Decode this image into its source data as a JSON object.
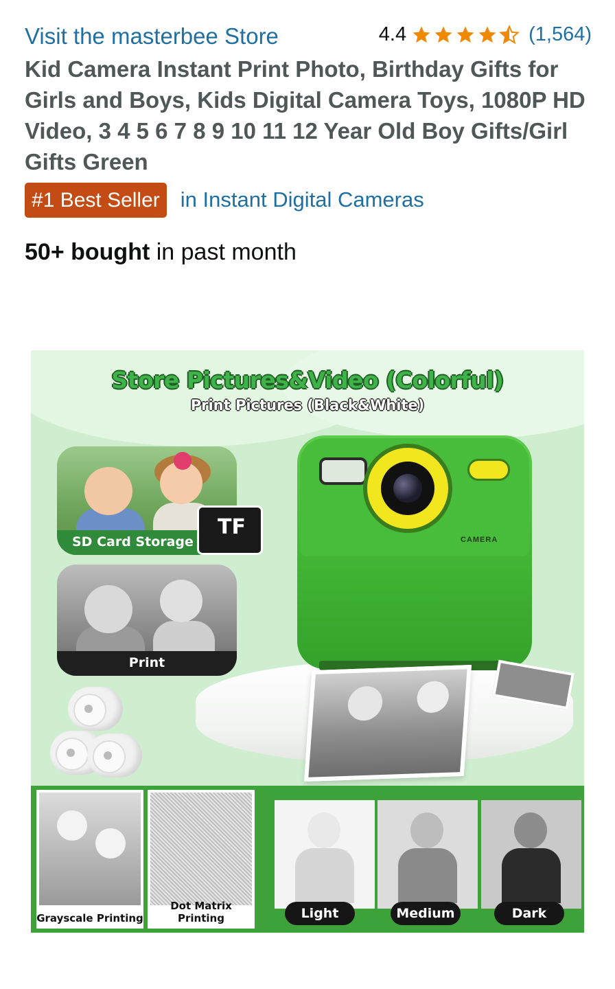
{
  "store": {
    "link_text": "Visit the masterbee Store",
    "rating_value": "4.4",
    "rating_stars": 4.4,
    "rating_count": "(1,564)",
    "star_color": "#f08804"
  },
  "product": {
    "title": "Kid Camera Instant Print Photo, Birthday Gifts for Girls and Boys, Kids Digital Camera Toys, 1080P HD Video, 3 4 5 6 7 8 9 10 11 12 Year Old Boy Gifts/Girl Gifts Green",
    "badge": "#1 Best Seller",
    "badge_category": "in Instant Digital Cameras",
    "bought_bold": "50+ bought",
    "bought_rest": " in past month"
  },
  "image": {
    "headline": "Store Pictures&Video (Colorful)",
    "subline": "Print Pictures (Black&White)",
    "sd_label": "SD Card Storage",
    "tf_label": "TF",
    "print_label": "Print",
    "camera_text": "CAMERA",
    "tiles": {
      "grayscale": "Grayscale Printing",
      "dotmatrix": "Dot Matrix Printing",
      "light": "Light",
      "medium": "Medium",
      "dark": "Dark"
    }
  },
  "colors": {
    "link": "#1f6fa1",
    "badge_bg": "#c24c13",
    "camera_green": "#3fb233",
    "lens_yellow": "#f2e61f"
  }
}
